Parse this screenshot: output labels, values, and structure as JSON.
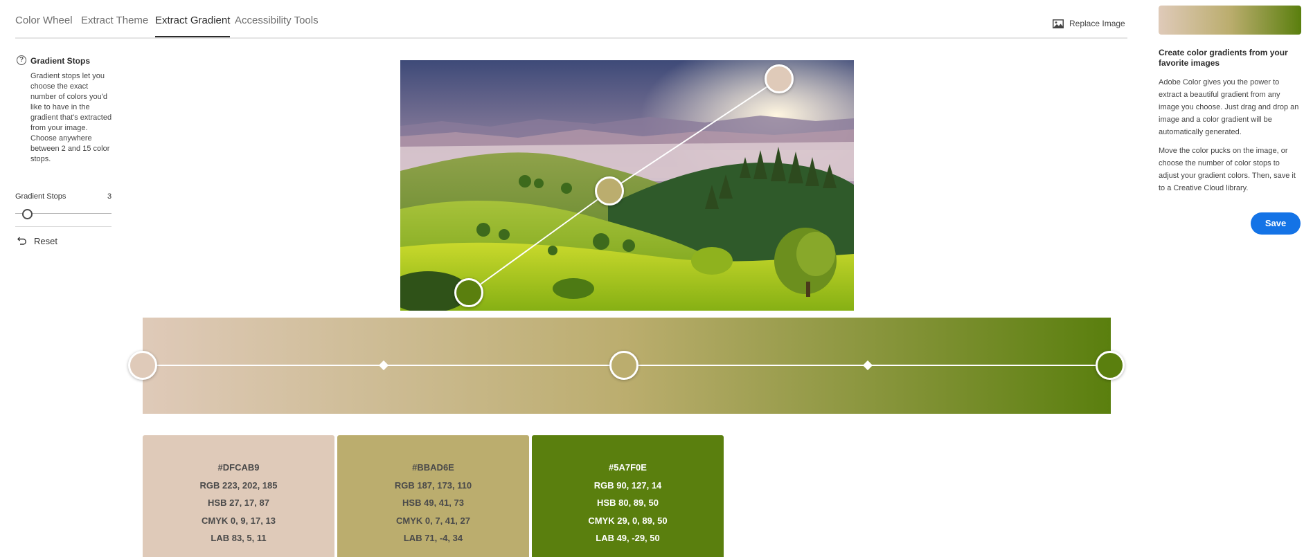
{
  "tabs": [
    {
      "label": "Color Wheel"
    },
    {
      "label": "Extract Theme"
    },
    {
      "label": "Extract Gradient"
    },
    {
      "label": "Accessibility Tools"
    }
  ],
  "active_tab": "Extract Gradient",
  "replace_image_label": "Replace Image",
  "left_panel": {
    "title": "Gradient Stops",
    "description": "Gradient stops let you choose the exact number of colors you'd like to have in the gradient that's extracted from your image. Choose anywhere between 2 and 15 color stops.",
    "slider_label": "Gradient Stops",
    "slider_value": "3",
    "slider_min": 2,
    "slider_max": 15,
    "reset_label": "Reset"
  },
  "image": {
    "description_icon": "landscape-image"
  },
  "gradient": {
    "colors": [
      "#DFCAB9",
      "#BBAD6E",
      "#5A7F0E"
    ]
  },
  "swatches": [
    {
      "hex": "#DFCAB9",
      "rgb": "RGB 223, 202, 185",
      "hsb": "HSB 27, 17, 87",
      "cmyk": "CMYK 0, 9, 17, 13",
      "lab": "LAB 83, 5, 11",
      "text_color": "#4a4a4a"
    },
    {
      "hex": "#BBAD6E",
      "rgb": "RGB 187, 173, 110",
      "hsb": "HSB 49, 41, 73",
      "cmyk": "CMYK 0, 7, 41, 27",
      "lab": "LAB 71, -4, 34",
      "text_color": "#4a4a4a"
    },
    {
      "hex": "#5A7F0E",
      "rgb": "RGB 90, 127, 14",
      "hsb": "HSB 80, 89, 50",
      "cmyk": "CMYK 29, 0, 89, 50",
      "lab": "LAB 49, -29, 50",
      "text_color": "#ffffff"
    }
  ],
  "right_panel": {
    "title": "Create color gradients from your favorite images",
    "paragraph1": "Adobe Color gives you the power to extract a beautiful gradient from any image you choose. Just drag and drop an image and a color gradient will be automatically generated.",
    "paragraph2": "Move the color pucks on the image, or choose the number of color stops to adjust your gradient colors. Then, save it to a Creative Cloud library.",
    "save_label": "Save"
  },
  "colors": {
    "accent": "#1473e6",
    "text": "#2c2c2c",
    "muted": "#6e6e6e"
  }
}
